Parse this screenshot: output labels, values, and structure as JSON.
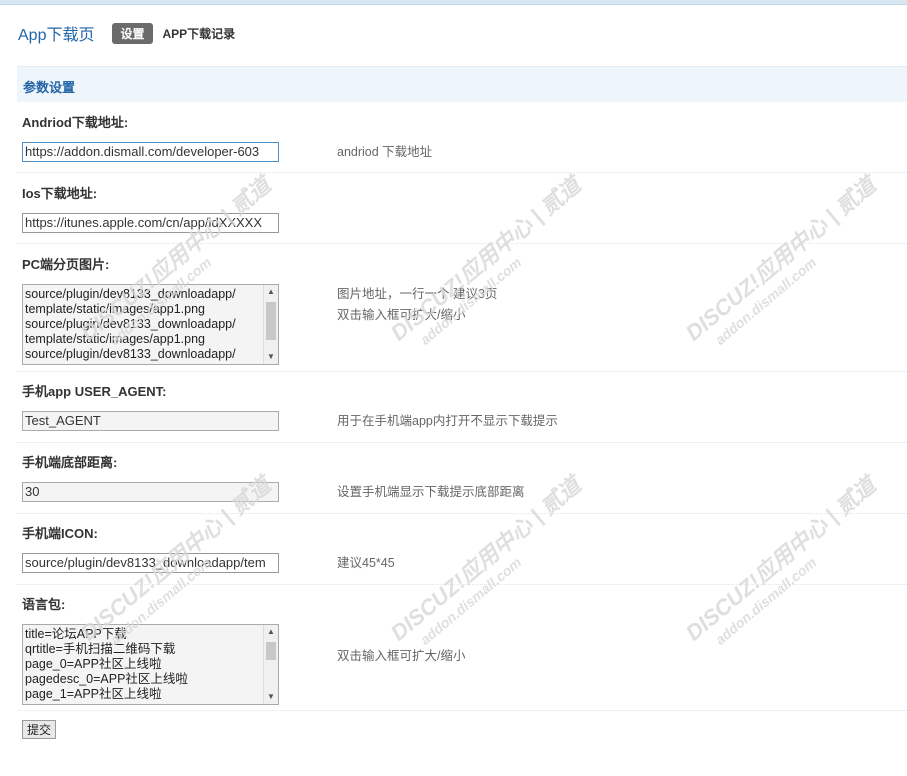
{
  "header": {
    "app_title": "App下载页",
    "tab_settings": "设置",
    "tab_records": "APP下载记录"
  },
  "section": {
    "title": "参数设置"
  },
  "fields": {
    "android": {
      "label": "Andriod下载地址:",
      "value": "https://addon.dismall.com/developer-603",
      "tip": "andriod 下载地址"
    },
    "ios": {
      "label": "Ios下载地址:",
      "value": "https://itunes.apple.com/cn/app/idXXXXX"
    },
    "pc_images": {
      "label": "PC端分页图片:",
      "lines": [
        "source/plugin/dev8133_downloadapp/",
        "template/static/images/app1.png",
        "source/plugin/dev8133_downloadapp/",
        "template/static/images/app1.png",
        "source/plugin/dev8133_downloadapp/"
      ],
      "tip1": "图片地址，一行一个 建议3页",
      "tip2": "双击输入框可扩大/缩小"
    },
    "user_agent": {
      "label": "手机app USER_AGENT:",
      "value": "Test_AGENT",
      "tip": "用于在手机端app内打开不显示下载提示"
    },
    "bottom_distance": {
      "label": "手机端底部距离:",
      "value": "30",
      "tip": "设置手机端显示下载提示底部距离"
    },
    "icon": {
      "label": "手机端ICON:",
      "value": "source/plugin/dev8133_downloadapp/tem",
      "tip": "建议45*45"
    },
    "language": {
      "label": "语言包:",
      "lines": [
        "title=论坛APP下载",
        "qrtitle=手机扫描二维码下载",
        "page_0=APP社区上线啦",
        "pagedesc_0=APP社区上线啦",
        "page_1=APP社区上线啦"
      ],
      "tip": "双击输入框可扩大/缩小"
    }
  },
  "submit_label": "提交",
  "watermark": {
    "line1": "DISCUZ!应用中心 | 贰道",
    "line2": "addon.dismall.com"
  }
}
